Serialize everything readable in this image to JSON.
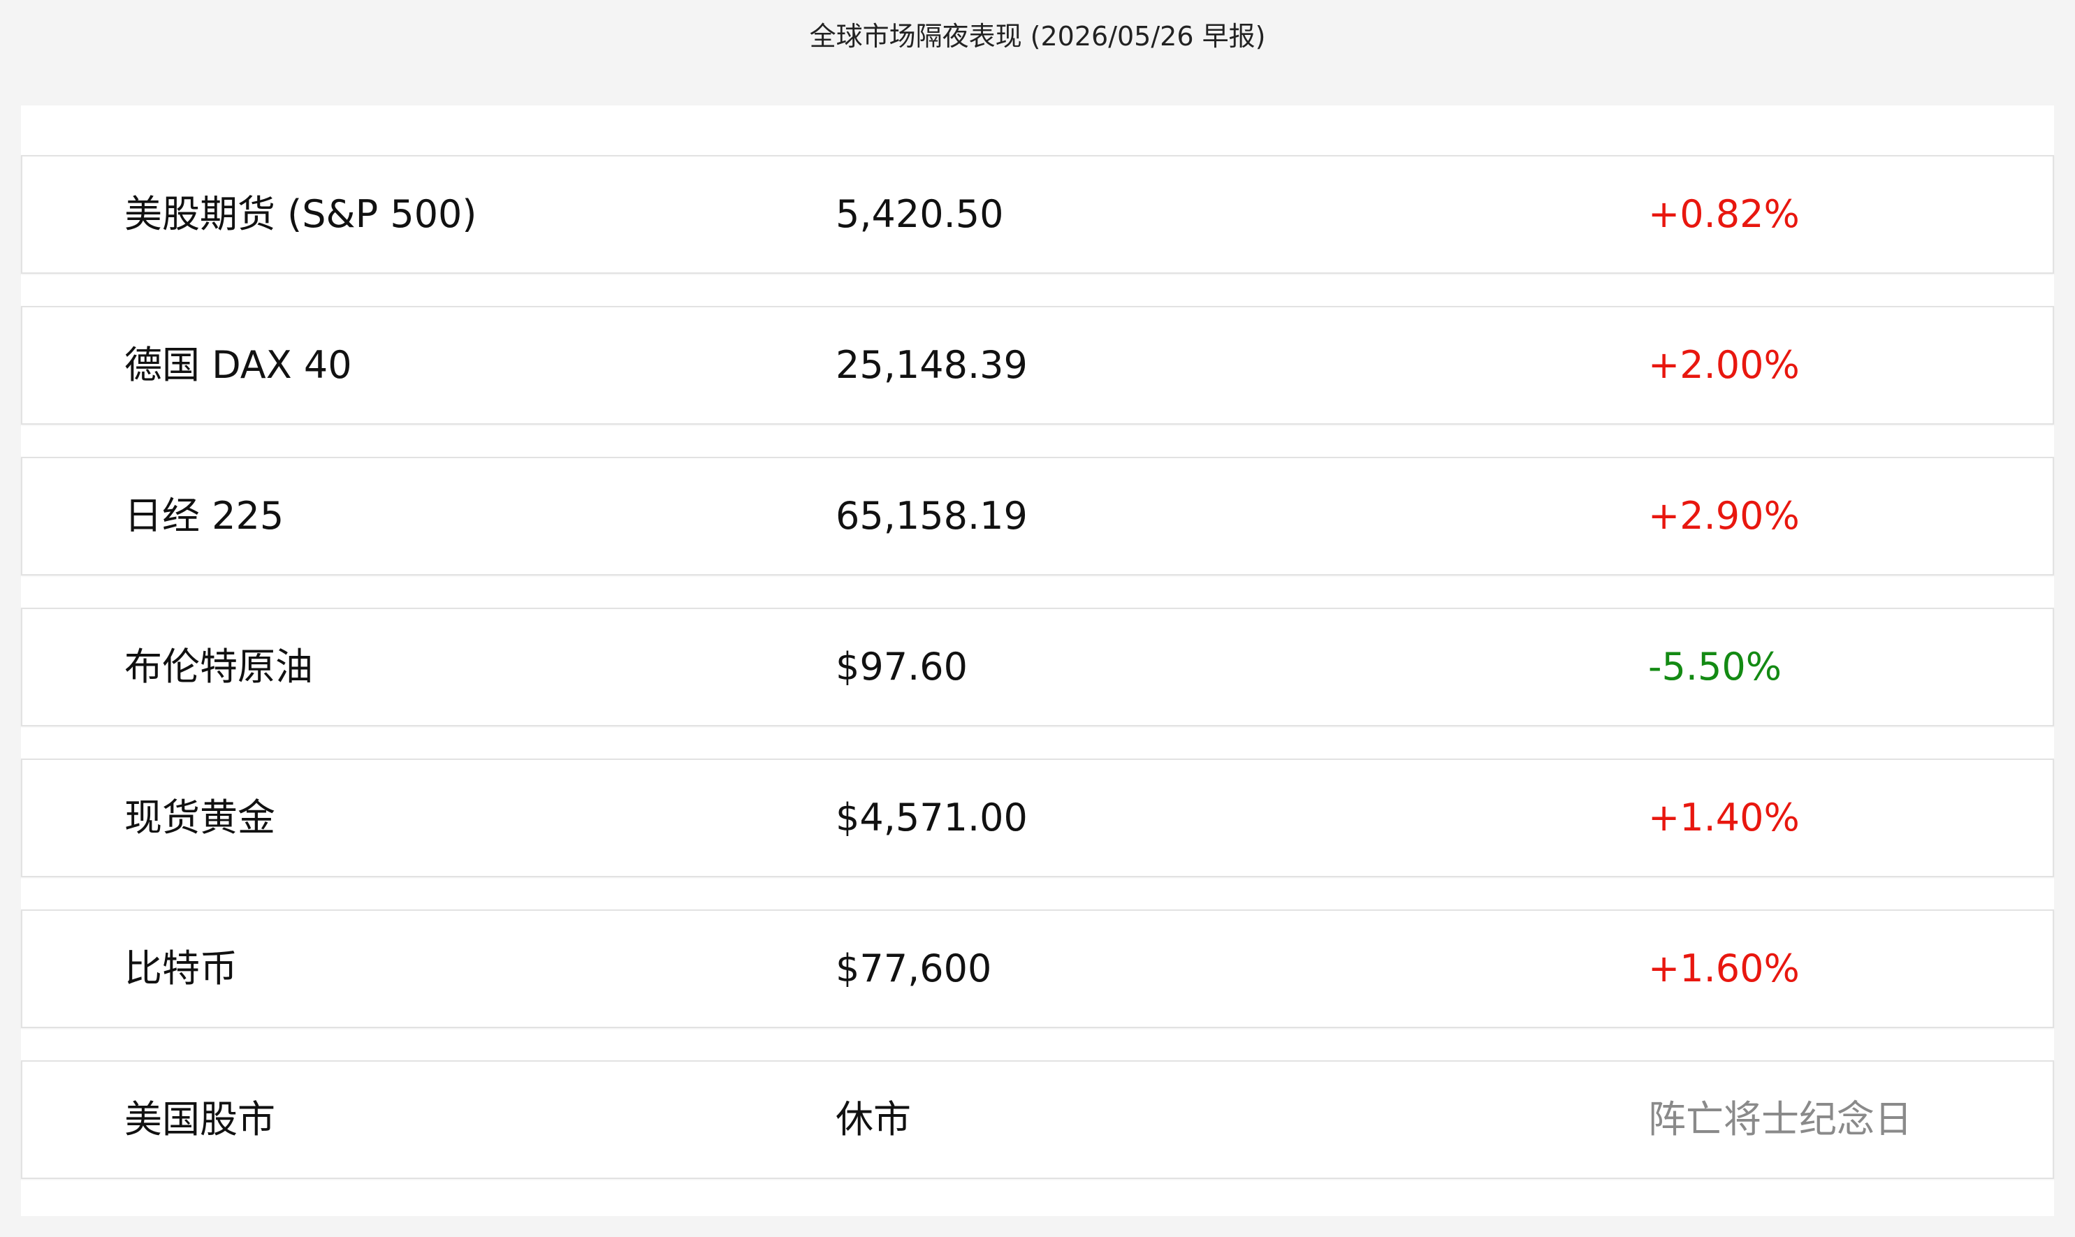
{
  "header": {
    "title": "全球市场隔夜表现 (2026/05/26 早报)"
  },
  "colors": {
    "up": "#e8170f",
    "down": "#138a13",
    "neutral": "#8a8a8a"
  },
  "rows": [
    {
      "name": "美股期货 (S&P 500)",
      "value": "5,420.50",
      "change": "+0.82%",
      "trend": "up"
    },
    {
      "name": "德国 DAX 40",
      "value": "25,148.39",
      "change": "+2.00%",
      "trend": "up"
    },
    {
      "name": "日经 225",
      "value": "65,158.19",
      "change": "+2.90%",
      "trend": "up"
    },
    {
      "name": "布伦特原油",
      "value": "$97.60",
      "change": "-5.50%",
      "trend": "down"
    },
    {
      "name": "现货黄金",
      "value": "$4,571.00",
      "change": "+1.40%",
      "trend": "up"
    },
    {
      "name": "比特币",
      "value": "$77,600",
      "change": "+1.60%",
      "trend": "up"
    },
    {
      "name": "美国股市",
      "value": "休市",
      "change": "阵亡将士纪念日",
      "trend": "neutral"
    }
  ]
}
